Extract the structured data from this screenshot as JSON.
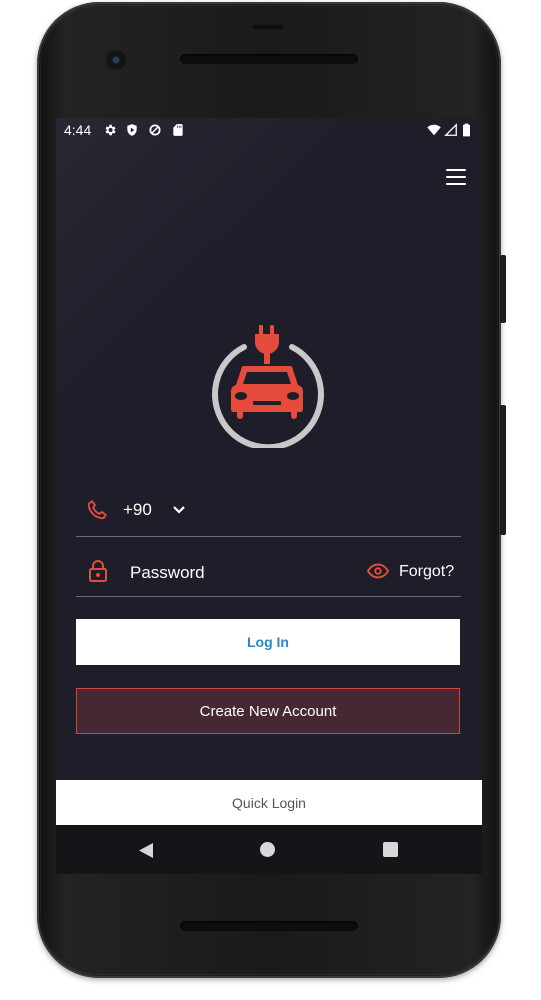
{
  "status_bar": {
    "time": "4:44",
    "left_icons": [
      "settings-icon",
      "shield-icon",
      "data-saver-icon",
      "sd-card-icon"
    ],
    "right_icons": [
      "wifi-icon",
      "signal-icon",
      "battery-icon"
    ]
  },
  "header": {
    "menu_icon": "hamburger-menu-icon"
  },
  "logo": {
    "icon": "ev-charging-car-icon",
    "accent": "#e64c3c",
    "ring": "#c8c8c8"
  },
  "login_form": {
    "phone": {
      "country_code": "+90",
      "icon": "phone-icon",
      "dropdown_icon": "chevron-down-icon"
    },
    "password": {
      "placeholder": "Password",
      "icon": "lock-icon",
      "visibility_icon": "eye-icon",
      "forgot_label": "Forgot?"
    },
    "login_button": "Log In",
    "create_account_button": "Create New Account"
  },
  "quick_login": {
    "label": "Quick Login"
  },
  "colors": {
    "background": "#1e1e2a",
    "accent": "#e64c3c",
    "link_blue": "#2b86c5"
  }
}
